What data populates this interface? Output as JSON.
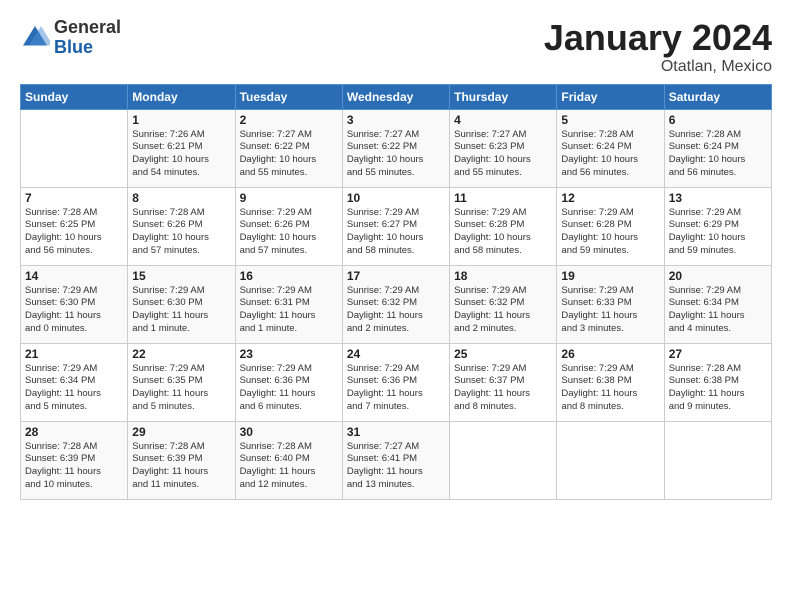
{
  "logo": {
    "general": "General",
    "blue": "Blue"
  },
  "title": "January 2024",
  "subtitle": "Otatlan, Mexico",
  "headers": [
    "Sunday",
    "Monday",
    "Tuesday",
    "Wednesday",
    "Thursday",
    "Friday",
    "Saturday"
  ],
  "weeks": [
    [
      {
        "day": "",
        "info": ""
      },
      {
        "day": "1",
        "info": "Sunrise: 7:26 AM\nSunset: 6:21 PM\nDaylight: 10 hours\nand 54 minutes."
      },
      {
        "day": "2",
        "info": "Sunrise: 7:27 AM\nSunset: 6:22 PM\nDaylight: 10 hours\nand 55 minutes."
      },
      {
        "day": "3",
        "info": "Sunrise: 7:27 AM\nSunset: 6:22 PM\nDaylight: 10 hours\nand 55 minutes."
      },
      {
        "day": "4",
        "info": "Sunrise: 7:27 AM\nSunset: 6:23 PM\nDaylight: 10 hours\nand 55 minutes."
      },
      {
        "day": "5",
        "info": "Sunrise: 7:28 AM\nSunset: 6:24 PM\nDaylight: 10 hours\nand 56 minutes."
      },
      {
        "day": "6",
        "info": "Sunrise: 7:28 AM\nSunset: 6:24 PM\nDaylight: 10 hours\nand 56 minutes."
      }
    ],
    [
      {
        "day": "7",
        "info": "Sunrise: 7:28 AM\nSunset: 6:25 PM\nDaylight: 10 hours\nand 56 minutes."
      },
      {
        "day": "8",
        "info": "Sunrise: 7:28 AM\nSunset: 6:26 PM\nDaylight: 10 hours\nand 57 minutes."
      },
      {
        "day": "9",
        "info": "Sunrise: 7:29 AM\nSunset: 6:26 PM\nDaylight: 10 hours\nand 57 minutes."
      },
      {
        "day": "10",
        "info": "Sunrise: 7:29 AM\nSunset: 6:27 PM\nDaylight: 10 hours\nand 58 minutes."
      },
      {
        "day": "11",
        "info": "Sunrise: 7:29 AM\nSunset: 6:28 PM\nDaylight: 10 hours\nand 58 minutes."
      },
      {
        "day": "12",
        "info": "Sunrise: 7:29 AM\nSunset: 6:28 PM\nDaylight: 10 hours\nand 59 minutes."
      },
      {
        "day": "13",
        "info": "Sunrise: 7:29 AM\nSunset: 6:29 PM\nDaylight: 10 hours\nand 59 minutes."
      }
    ],
    [
      {
        "day": "14",
        "info": "Sunrise: 7:29 AM\nSunset: 6:30 PM\nDaylight: 11 hours\nand 0 minutes."
      },
      {
        "day": "15",
        "info": "Sunrise: 7:29 AM\nSunset: 6:30 PM\nDaylight: 11 hours\nand 1 minute."
      },
      {
        "day": "16",
        "info": "Sunrise: 7:29 AM\nSunset: 6:31 PM\nDaylight: 11 hours\nand 1 minute."
      },
      {
        "day": "17",
        "info": "Sunrise: 7:29 AM\nSunset: 6:32 PM\nDaylight: 11 hours\nand 2 minutes."
      },
      {
        "day": "18",
        "info": "Sunrise: 7:29 AM\nSunset: 6:32 PM\nDaylight: 11 hours\nand 2 minutes."
      },
      {
        "day": "19",
        "info": "Sunrise: 7:29 AM\nSunset: 6:33 PM\nDaylight: 11 hours\nand 3 minutes."
      },
      {
        "day": "20",
        "info": "Sunrise: 7:29 AM\nSunset: 6:34 PM\nDaylight: 11 hours\nand 4 minutes."
      }
    ],
    [
      {
        "day": "21",
        "info": "Sunrise: 7:29 AM\nSunset: 6:34 PM\nDaylight: 11 hours\nand 5 minutes."
      },
      {
        "day": "22",
        "info": "Sunrise: 7:29 AM\nSunset: 6:35 PM\nDaylight: 11 hours\nand 5 minutes."
      },
      {
        "day": "23",
        "info": "Sunrise: 7:29 AM\nSunset: 6:36 PM\nDaylight: 11 hours\nand 6 minutes."
      },
      {
        "day": "24",
        "info": "Sunrise: 7:29 AM\nSunset: 6:36 PM\nDaylight: 11 hours\nand 7 minutes."
      },
      {
        "day": "25",
        "info": "Sunrise: 7:29 AM\nSunset: 6:37 PM\nDaylight: 11 hours\nand 8 minutes."
      },
      {
        "day": "26",
        "info": "Sunrise: 7:29 AM\nSunset: 6:38 PM\nDaylight: 11 hours\nand 8 minutes."
      },
      {
        "day": "27",
        "info": "Sunrise: 7:28 AM\nSunset: 6:38 PM\nDaylight: 11 hours\nand 9 minutes."
      }
    ],
    [
      {
        "day": "28",
        "info": "Sunrise: 7:28 AM\nSunset: 6:39 PM\nDaylight: 11 hours\nand 10 minutes."
      },
      {
        "day": "29",
        "info": "Sunrise: 7:28 AM\nSunset: 6:39 PM\nDaylight: 11 hours\nand 11 minutes."
      },
      {
        "day": "30",
        "info": "Sunrise: 7:28 AM\nSunset: 6:40 PM\nDaylight: 11 hours\nand 12 minutes."
      },
      {
        "day": "31",
        "info": "Sunrise: 7:27 AM\nSunset: 6:41 PM\nDaylight: 11 hours\nand 13 minutes."
      },
      {
        "day": "",
        "info": ""
      },
      {
        "day": "",
        "info": ""
      },
      {
        "day": "",
        "info": ""
      }
    ]
  ]
}
